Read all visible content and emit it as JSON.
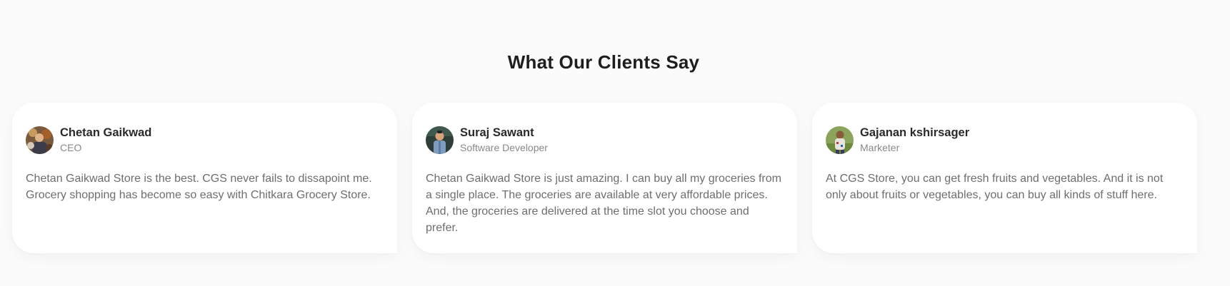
{
  "section": {
    "title": "What Our Clients Say"
  },
  "testimonials": [
    {
      "name": "Chetan Gaikwad",
      "role": "CEO",
      "quote": "Chetan Gaikwad Store is the best. CGS never fails to dissapoint me. Grocery shopping has become so easy with Chitkara Grocery Store.",
      "avatar_icon": "person-photo-icon"
    },
    {
      "name": "Suraj Sawant",
      "role": "Software Developer",
      "quote": "Chetan Gaikwad Store is just amazing. I can buy all my groceries from a single place. The groceries are available at very affordable prices. And, the groceries are delivered at the time slot you choose and prefer.",
      "avatar_icon": "person-photo-icon"
    },
    {
      "name": "Gajanan kshirsager",
      "role": "Marketer",
      "quote": "At CGS Store, you can get fresh fruits and vegetables. And it is not only about fruits or vegetables, you can buy all kinds of stuff here.",
      "avatar_icon": "person-photo-icon"
    }
  ],
  "colors": {
    "background": "#fbfbfb",
    "card": "#ffffff",
    "title": "#1e1e1e",
    "name": "#2a2a2a",
    "role": "#8a8a8a",
    "quote": "#6e6e6e"
  }
}
